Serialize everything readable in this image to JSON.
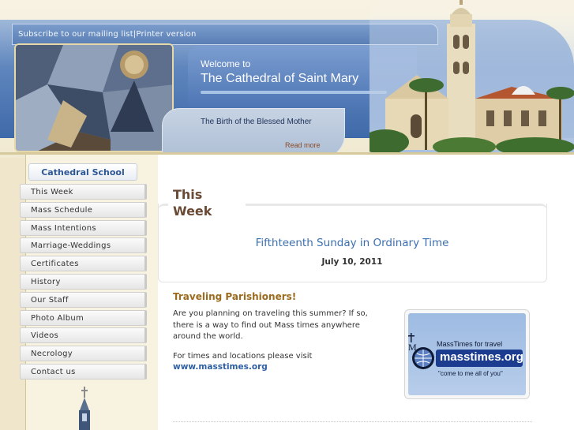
{
  "header": {
    "top_links": [
      "Subscribe to our mailing list",
      "Printer version"
    ],
    "link_separator": "|",
    "welcome_small": "Welcome to",
    "welcome_title": "The Cathedral of Saint Mary",
    "feature_title": "The Birth of the Blessed Mother",
    "read_more": "Read more"
  },
  "sidebar": {
    "school_tab": "Cathedral School",
    "items": [
      {
        "label": "This Week"
      },
      {
        "label": "Mass Schedule"
      },
      {
        "label": "Mass Intentions"
      },
      {
        "label": "Marriage-Weddings"
      },
      {
        "label": "Certificates"
      },
      {
        "label": "History"
      },
      {
        "label": "Our Staff"
      },
      {
        "label": "Photo Album"
      },
      {
        "label": "Videos"
      },
      {
        "label": "Necrology"
      },
      {
        "label": "Contact us"
      }
    ]
  },
  "main": {
    "section_heading_line1": "This",
    "section_heading_line2": "Week",
    "sunday_title": "Fifthteenth Sunday in Ordinary Time",
    "date": "July 10, 2011",
    "article": {
      "title": "Traveling Parishioners!",
      "paragraph1": "Are you planning on traveling this summer? If so, there is a way to find out Mass times anywhere around the world.",
      "paragraph2": "For times and locations please visit",
      "link": "www.masstimes.org"
    },
    "ad": {
      "heading": "MassTimes for travel",
      "brand": "masstimes.org",
      "tagline": "\"come to me all of you\""
    }
  },
  "colors": {
    "header_blue": "#4e76b4",
    "link_blue": "#2e5fa3",
    "heading_brown": "#6a4a35",
    "article_gold": "#9b6a1c",
    "background_cream": "#efe6cc"
  }
}
